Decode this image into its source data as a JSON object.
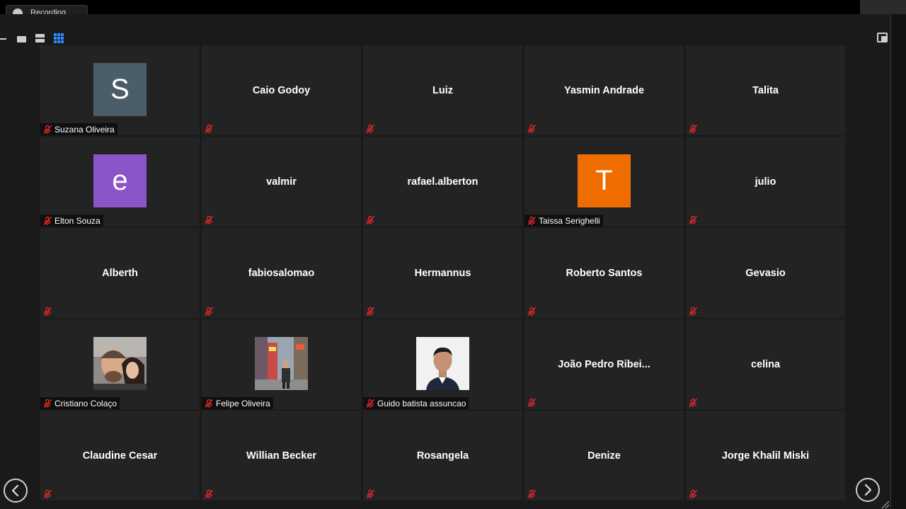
{
  "recording": {
    "label": "Recording"
  },
  "icons": {
    "mute": "mic-off-icon",
    "prev": "chevron-left-icon",
    "next": "chevron-right-icon",
    "gallery": "gallery-view-icon",
    "speaker": "speaker-view-icon",
    "strip": "strip-view-icon",
    "exit": "exit-fullscreen-icon"
  },
  "colors": {
    "accent": "#2d8cff",
    "mute": "#e02828",
    "tile_bg": "#232323",
    "app_bg": "#1a1a1a"
  },
  "participants": [
    {
      "name": "Suzana Oliveira",
      "display": "avatar",
      "initial": "S",
      "avatar_color": "#4a5d68"
    },
    {
      "name": "Caio Godoy",
      "display": "name"
    },
    {
      "name": "Luiz",
      "display": "name"
    },
    {
      "name": "Yasmin Andrade",
      "display": "name"
    },
    {
      "name": "Talita",
      "display": "name"
    },
    {
      "name": "Elton Souza",
      "display": "avatar",
      "initial": "e",
      "avatar_color": "#8b54c8"
    },
    {
      "name": "valmir",
      "display": "name"
    },
    {
      "name": "rafael.alberton",
      "display": "name"
    },
    {
      "name": "Taissa Serighelli",
      "display": "avatar",
      "initial": "T",
      "avatar_color": "#ef6c00"
    },
    {
      "name": "julio",
      "display": "name"
    },
    {
      "name": "Alberth",
      "display": "name"
    },
    {
      "name": "fabiosalomao",
      "display": "name"
    },
    {
      "name": "Hermannus",
      "display": "name"
    },
    {
      "name": "Roberto Santos",
      "display": "name"
    },
    {
      "name": "Gevasio",
      "display": "name"
    },
    {
      "name": "Cristiano Colaço",
      "display": "photo",
      "photo": "couple"
    },
    {
      "name": "Felipe Oliveira",
      "display": "photo",
      "photo": "city"
    },
    {
      "name": "Guido batista assuncao",
      "display": "photo",
      "photo": "portrait"
    },
    {
      "name": "João Pedro Ribei...",
      "display": "name"
    },
    {
      "name": "celina",
      "display": "name"
    },
    {
      "name": "Claudine Cesar",
      "display": "name"
    },
    {
      "name": "Willian Becker",
      "display": "name"
    },
    {
      "name": "Rosangela",
      "display": "name"
    },
    {
      "name": "Denize",
      "display": "name"
    },
    {
      "name": "Jorge Khalil Miski",
      "display": "name"
    }
  ]
}
